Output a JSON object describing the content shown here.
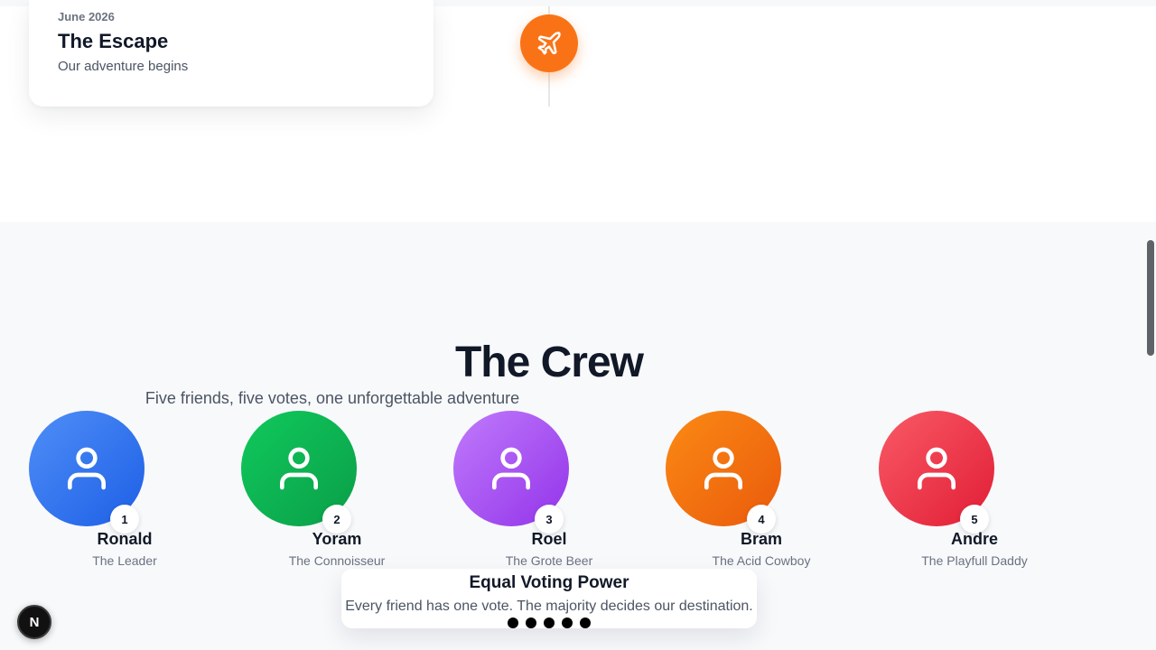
{
  "timeline": {
    "date": "June 2026",
    "title": "The Escape",
    "subtitle": "Our adventure begins",
    "icon": "plane-icon",
    "accent_color": "#f97316"
  },
  "crew": {
    "title": "The Crew",
    "subtitle": "Five friends, five votes, one unforgettable adventure",
    "members": [
      {
        "number": "1",
        "name": "Ronald",
        "role": "The Leader",
        "icon": "user-icon",
        "color": "#2f73f0"
      },
      {
        "number": "2",
        "name": "Yoram",
        "role": "The Connoisseur",
        "icon": "user-icon",
        "color": "#0cb552"
      },
      {
        "number": "3",
        "name": "Roel",
        "role": "The Grote Beer",
        "icon": "user-icon",
        "color": "#a855f7"
      },
      {
        "number": "4",
        "name": "Bram",
        "role": "The Acid Cowboy",
        "icon": "user-icon",
        "color": "#f26f10"
      },
      {
        "number": "5",
        "name": "Andre",
        "role": "The Playfull Daddy",
        "icon": "user-icon",
        "color": "#ee3446"
      }
    ]
  },
  "voting": {
    "title": "Equal Voting Power",
    "text": "Every friend has one vote. The majority decides our destination.",
    "dot_count": 5
  },
  "dev_badge": {
    "label": "N"
  }
}
